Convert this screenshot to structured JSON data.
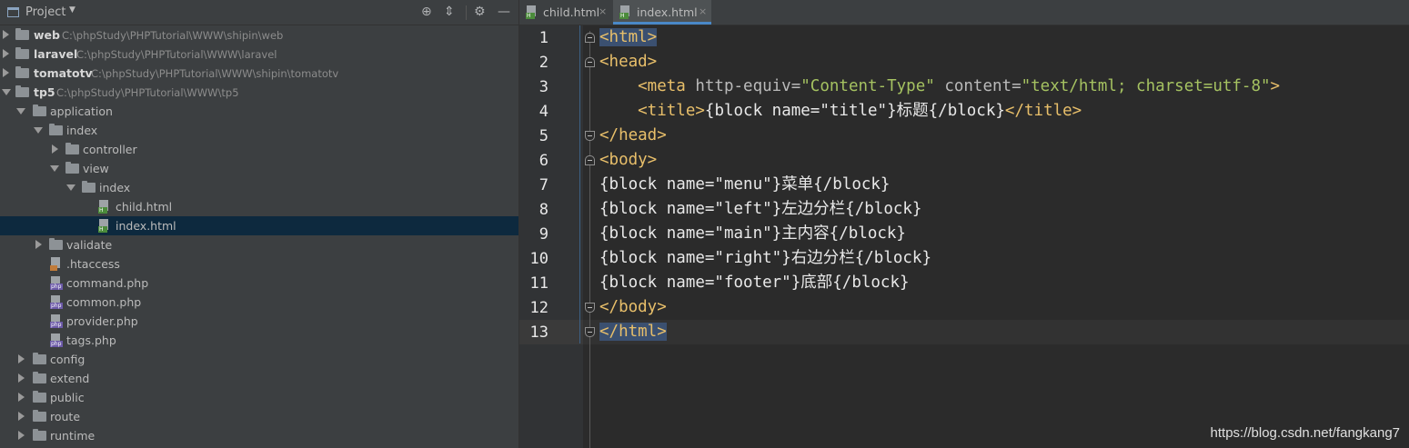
{
  "project_panel": {
    "title": "Project",
    "icons": [
      "target-icon",
      "collapse-all-icon",
      "gear-icon",
      "minimize-icon"
    ],
    "tree": [
      {
        "label": "web",
        "path": "C:\\phpStudy\\PHPTutorial\\WWW\\shipin\\web",
        "type": "root"
      },
      {
        "label": "laravel",
        "path": "C:\\phpStudy\\PHPTutorial\\WWW\\laravel",
        "type": "root"
      },
      {
        "label": "tomatotv",
        "path": "C:\\phpStudy\\PHPTutorial\\WWW\\shipin\\tomatotv",
        "type": "root"
      },
      {
        "label": "tp5",
        "path": "C:\\phpStudy\\PHPTutorial\\WWW\\tp5",
        "type": "root"
      },
      {
        "label": "application",
        "type": "folder"
      },
      {
        "label": "index",
        "type": "folder"
      },
      {
        "label": "controller",
        "type": "folder"
      },
      {
        "label": "view",
        "type": "folder"
      },
      {
        "label": "index",
        "type": "folder"
      },
      {
        "label": "child.html",
        "type": "html"
      },
      {
        "label": "index.html",
        "type": "html"
      },
      {
        "label": "validate",
        "type": "folder"
      },
      {
        "label": ".htaccess",
        "type": "htaccess"
      },
      {
        "label": "command.php",
        "type": "php"
      },
      {
        "label": "common.php",
        "type": "php"
      },
      {
        "label": "provider.php",
        "type": "php"
      },
      {
        "label": "tags.php",
        "type": "php"
      },
      {
        "label": "config",
        "type": "folder"
      },
      {
        "label": "extend",
        "type": "folder"
      },
      {
        "label": "public",
        "type": "folder"
      },
      {
        "label": "route",
        "type": "folder"
      },
      {
        "label": "runtime",
        "type": "folder"
      }
    ]
  },
  "editor": {
    "tabs": [
      {
        "label": "child.html",
        "close": "×",
        "active": false
      },
      {
        "label": "index.html",
        "close": "×",
        "active": true
      }
    ],
    "line_numbers": [
      "1",
      "2",
      "3",
      "4",
      "5",
      "6",
      "7",
      "8",
      "9",
      "10",
      "11",
      "12",
      "13"
    ],
    "code": {
      "l1": "<html>",
      "l2": "<head>",
      "l3_tag_open": "    <meta ",
      "l3_attr1": "http-equiv=",
      "l3_val1": "\"Content-Type\"",
      "l3_attr2": " content=",
      "l3_val2": "\"text/html; charset=utf-8\"",
      "l3_tag_close": ">",
      "l4_tag_open": "    <title>",
      "l4_text": "{block name=\"title\"}标题{/block}",
      "l4_tag_close": "</title>",
      "l5": "</head>",
      "l6": "<body>",
      "l7": "{block name=\"menu\"}菜单{/block}",
      "l8": "{block name=\"left\"}左边分栏{/block}",
      "l9": "{block name=\"main\"}主内容{/block}",
      "l10": "{block name=\"right\"}右边分栏{/block}",
      "l11": "{block name=\"footer\"}底部{/block}",
      "l12": "</body>",
      "l13": "</html>"
    }
  },
  "watermark": "https://blog.csdn.net/fangkang7"
}
